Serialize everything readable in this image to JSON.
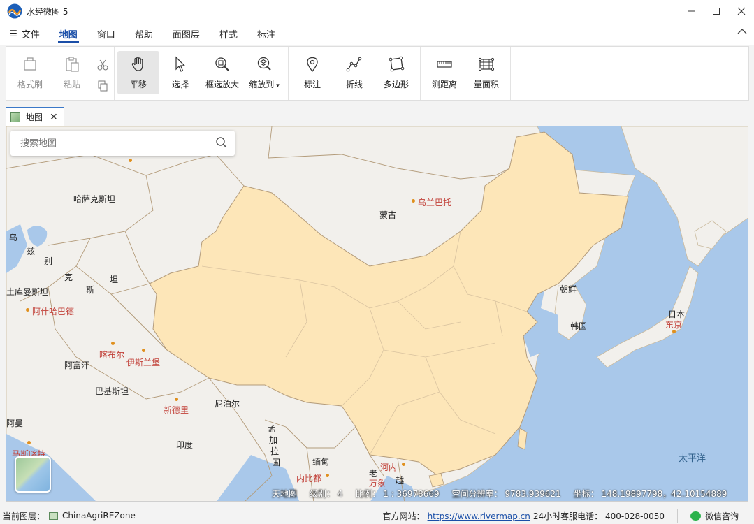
{
  "window": {
    "title": "水经微图 5"
  },
  "menu": {
    "items": [
      {
        "label": "文件"
      },
      {
        "label": "地图",
        "active": true
      },
      {
        "label": "窗口"
      },
      {
        "label": "帮助"
      },
      {
        "label": "面图层"
      },
      {
        "label": "样式"
      },
      {
        "label": "标注"
      }
    ]
  },
  "ribbon": {
    "format_painter": "格式刷",
    "paste": "粘贴",
    "pan": "平移",
    "select": "选择",
    "box_zoom": "框选放大",
    "zoom_to": "缩放到",
    "mark": "标注",
    "polyline": "折线",
    "polygon": "多边形",
    "measure_distance": "测距离",
    "measure_area": "量面积"
  },
  "tab": {
    "label": "地图"
  },
  "search": {
    "placeholder": "搜索地图"
  },
  "map_labels": {
    "kazakhstan": "哈萨克斯坦",
    "mongolia": "蒙古",
    "ulaanbaatar": "乌兰巴托",
    "uz_1": "乌",
    "uz_2": "兹",
    "uz_3": "别",
    "uz_4": "克",
    "uz_5": "斯",
    "uz_6": "坦",
    "turkmenistan": "土库曼斯坦",
    "ashgabat": "阿什哈巴德",
    "kabul": "喀布尔",
    "islamabad": "伊斯兰堡",
    "afghanistan": "阿富汗",
    "pakistan": "巴基斯坦",
    "new_delhi": "新德里",
    "nepal": "尼泊尔",
    "india": "印度",
    "bangladesh_1": "孟",
    "bangladesh_2": "加",
    "bangladesh_3": "拉",
    "bangladesh_4": "国",
    "myanmar": "缅甸",
    "naypyidaw": "内比都",
    "laos": "老",
    "vientiane": "万象",
    "vietnam": "越",
    "hanoi": "河内",
    "north_korea": "朝鲜",
    "south_korea": "韩国",
    "japan": "日本",
    "tokyo": "东京",
    "pacific": "太平洋",
    "muscat": "马斯喀特",
    "oman": "阿曼"
  },
  "scale_info": {
    "source": "天地图",
    "level": "级别： 4",
    "ratio": "比例： 1 : 36978669",
    "resolution": "空间分辨率： 9783.939621",
    "coords": "坐标： 148.19897798，42.10154889"
  },
  "status": {
    "layer_label": "当前图层：",
    "layer_name": "ChinaAgriREZone",
    "website_label": "官方网站：",
    "website_url": "https://www.rivermap.cn",
    "hotline": "24小时客服电话： 400-028-0050",
    "wechat": "微信咨询"
  },
  "colors": {
    "accent": "#1b4fa8",
    "ocean": "#a9c8ea",
    "land": "#f2f0ec",
    "china": "#fde6b8",
    "border": "#b39b7a"
  }
}
